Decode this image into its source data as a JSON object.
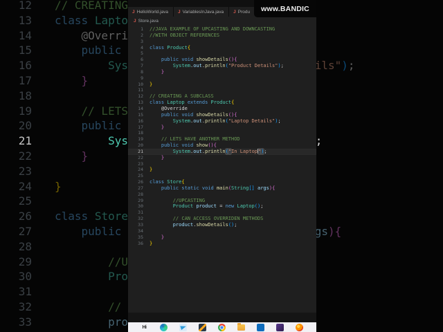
{
  "watermark": {
    "text": "www.BANDIC"
  },
  "window": {
    "tabs": [
      {
        "icon": "java-file-icon",
        "label": "HelloWorld.java"
      },
      {
        "icon": "java-file-icon",
        "label": "VariablesInJava.java"
      },
      {
        "icon": "java-file-icon",
        "label": "Produ"
      }
    ],
    "breadcrumb": {
      "icon": "java-file-icon",
      "label": "Store.java"
    }
  },
  "editor": {
    "language": "java",
    "current_line": 21,
    "lines": [
      {
        "n": 1,
        "tokens": [
          {
            "t": "//JAVA EXAMPLE OF UPCASTING AND DOWNCASTING",
            "c": "cm"
          }
        ]
      },
      {
        "n": 2,
        "tokens": [
          {
            "t": "//WITH OBJECT REFERENCES",
            "c": "cm"
          }
        ]
      },
      {
        "n": 3,
        "tokens": []
      },
      {
        "n": 4,
        "tokens": [
          {
            "t": "class",
            "c": "kw"
          },
          {
            "t": " ",
            "c": "tx"
          },
          {
            "t": "Product",
            "c": "cl"
          },
          {
            "t": "{",
            "c": "b1"
          }
        ]
      },
      {
        "n": 5,
        "tokens": []
      },
      {
        "n": 6,
        "tokens": [
          {
            "t": "    ",
            "c": "tx"
          },
          {
            "t": "public",
            "c": "kw"
          },
          {
            "t": " ",
            "c": "tx"
          },
          {
            "t": "void",
            "c": "kw"
          },
          {
            "t": " ",
            "c": "tx"
          },
          {
            "t": "showDetails",
            "c": "fn"
          },
          {
            "t": "(){",
            "c": "b2"
          }
        ]
      },
      {
        "n": 7,
        "tokens": [
          {
            "t": "        ",
            "c": "tx"
          },
          {
            "t": "System",
            "c": "cl"
          },
          {
            "t": ".",
            "c": "pu"
          },
          {
            "t": "out",
            "c": "pr"
          },
          {
            "t": ".",
            "c": "pu"
          },
          {
            "t": "println",
            "c": "fn"
          },
          {
            "t": "(",
            "c": "b3"
          },
          {
            "t": "\"Product Details\"",
            "c": "st"
          },
          {
            "t": ")",
            "c": "b3"
          },
          {
            "t": ";",
            "c": "tx"
          }
        ]
      },
      {
        "n": 8,
        "tokens": [
          {
            "t": "    ",
            "c": "tx"
          },
          {
            "t": "}",
            "c": "b2"
          }
        ]
      },
      {
        "n": 9,
        "tokens": []
      },
      {
        "n": 10,
        "tokens": [
          {
            "t": "}",
            "c": "b1"
          }
        ]
      },
      {
        "n": 11,
        "tokens": []
      },
      {
        "n": 12,
        "tokens": [
          {
            "t": "// CREATING A SUBCLASS",
            "c": "cm"
          }
        ]
      },
      {
        "n": 13,
        "tokens": [
          {
            "t": "class",
            "c": "kw"
          },
          {
            "t": " ",
            "c": "tx"
          },
          {
            "t": "Laptop",
            "c": "cl"
          },
          {
            "t": " ",
            "c": "tx"
          },
          {
            "t": "extends",
            "c": "kw"
          },
          {
            "t": " ",
            "c": "tx"
          },
          {
            "t": "Product",
            "c": "cl"
          },
          {
            "t": "{",
            "c": "b1"
          }
        ]
      },
      {
        "n": 14,
        "tokens": [
          {
            "t": "    @Override",
            "c": "tx"
          }
        ]
      },
      {
        "n": 15,
        "tokens": [
          {
            "t": "    ",
            "c": "tx"
          },
          {
            "t": "public",
            "c": "kw"
          },
          {
            "t": " ",
            "c": "tx"
          },
          {
            "t": "void",
            "c": "kw"
          },
          {
            "t": " ",
            "c": "tx"
          },
          {
            "t": "showDetails",
            "c": "fn"
          },
          {
            "t": "(){",
            "c": "b2"
          }
        ]
      },
      {
        "n": 16,
        "tokens": [
          {
            "t": "        ",
            "c": "tx"
          },
          {
            "t": "System",
            "c": "cl"
          },
          {
            "t": ".",
            "c": "pu"
          },
          {
            "t": "out",
            "c": "pr"
          },
          {
            "t": ".",
            "c": "pu"
          },
          {
            "t": "println",
            "c": "fn"
          },
          {
            "t": "(",
            "c": "b3"
          },
          {
            "t": "\"Laptop Details\"",
            "c": "st"
          },
          {
            "t": ")",
            "c": "b3"
          },
          {
            "t": ";",
            "c": "tx"
          }
        ]
      },
      {
        "n": 17,
        "tokens": [
          {
            "t": "    ",
            "c": "tx"
          },
          {
            "t": "}",
            "c": "b2"
          }
        ]
      },
      {
        "n": 18,
        "tokens": []
      },
      {
        "n": 19,
        "tokens": [
          {
            "t": "    ",
            "c": "tx"
          },
          {
            "t": "// LETS HAVE ANOTHER METHOD",
            "c": "cm"
          }
        ]
      },
      {
        "n": 20,
        "tokens": [
          {
            "t": "    ",
            "c": "tx"
          },
          {
            "t": "public",
            "c": "kw"
          },
          {
            "t": " ",
            "c": "tx"
          },
          {
            "t": "void",
            "c": "kw"
          },
          {
            "t": " ",
            "c": "tx"
          },
          {
            "t": "show",
            "c": "fn"
          },
          {
            "t": "(){",
            "c": "b2"
          }
        ]
      },
      {
        "n": 21,
        "tokens": [
          {
            "t": "        ",
            "c": "tx"
          },
          {
            "t": "System",
            "c": "cl"
          },
          {
            "t": ".",
            "c": "pu"
          },
          {
            "t": "out",
            "c": "pr"
          },
          {
            "t": ".",
            "c": "pu"
          },
          {
            "t": "println",
            "c": "fn"
          },
          {
            "t": "(",
            "c": "b3 h"
          },
          {
            "t": "\"",
            "c": "st h"
          },
          {
            "t": "In Laptop",
            "c": "st"
          },
          {
            "t": "",
            "c": "tx",
            "cur": true
          },
          {
            "t": "\"",
            "c": "st h"
          },
          {
            "t": ")",
            "c": "b3 h"
          },
          {
            "t": ";",
            "c": "tx"
          }
        ]
      },
      {
        "n": 22,
        "tokens": [
          {
            "t": "    ",
            "c": "tx"
          },
          {
            "t": "}",
            "c": "b2"
          }
        ]
      },
      {
        "n": 23,
        "tokens": []
      },
      {
        "n": 24,
        "tokens": [
          {
            "t": "}",
            "c": "b1"
          }
        ]
      },
      {
        "n": 25,
        "tokens": []
      },
      {
        "n": 26,
        "tokens": [
          {
            "t": "class",
            "c": "kw"
          },
          {
            "t": " ",
            "c": "tx"
          },
          {
            "t": "Store",
            "c": "cl"
          },
          {
            "t": "{",
            "c": "b1"
          }
        ]
      },
      {
        "n": 27,
        "tokens": [
          {
            "t": "    ",
            "c": "tx"
          },
          {
            "t": "public",
            "c": "kw"
          },
          {
            "t": " ",
            "c": "tx"
          },
          {
            "t": "static",
            "c": "kw"
          },
          {
            "t": " ",
            "c": "tx"
          },
          {
            "t": "void",
            "c": "kw"
          },
          {
            "t": " ",
            "c": "tx"
          },
          {
            "t": "main",
            "c": "fn"
          },
          {
            "t": "(",
            "c": "b2"
          },
          {
            "t": "String",
            "c": "cl"
          },
          {
            "t": "[]",
            "c": "b3"
          },
          {
            "t": " ",
            "c": "tx"
          },
          {
            "t": "args",
            "c": "pr"
          },
          {
            "t": "){",
            "c": "b2"
          }
        ]
      },
      {
        "n": 28,
        "tokens": []
      },
      {
        "n": 29,
        "tokens": [
          {
            "t": "        ",
            "c": "tx"
          },
          {
            "t": "//UPCASTING",
            "c": "cm"
          }
        ]
      },
      {
        "n": 30,
        "tokens": [
          {
            "t": "        ",
            "c": "tx"
          },
          {
            "t": "Product",
            "c": "cl"
          },
          {
            "t": " ",
            "c": "tx"
          },
          {
            "t": "product",
            "c": "pr"
          },
          {
            "t": " ",
            "c": "tx"
          },
          {
            "t": "=",
            "c": "pu"
          },
          {
            "t": " ",
            "c": "tx"
          },
          {
            "t": "new",
            "c": "kw"
          },
          {
            "t": " ",
            "c": "tx"
          },
          {
            "t": "Laptop",
            "c": "cl"
          },
          {
            "t": "()",
            "c": "b3"
          },
          {
            "t": ";",
            "c": "tx"
          }
        ]
      },
      {
        "n": 31,
        "tokens": []
      },
      {
        "n": 32,
        "tokens": [
          {
            "t": "        ",
            "c": "tx"
          },
          {
            "t": "// CAN ACCESS OVERRIDEN METHODS",
            "c": "cm"
          }
        ]
      },
      {
        "n": 33,
        "tokens": [
          {
            "t": "        ",
            "c": "tx"
          },
          {
            "t": "product",
            "c": "pr"
          },
          {
            "t": ".",
            "c": "pu"
          },
          {
            "t": "showDetails",
            "c": "fn"
          },
          {
            "t": "()",
            "c": "b3"
          },
          {
            "t": ";",
            "c": "tx"
          }
        ]
      },
      {
        "n": 34,
        "tokens": []
      },
      {
        "n": 35,
        "tokens": [
          {
            "t": "    ",
            "c": "tx"
          },
          {
            "t": "}",
            "c": "b2"
          }
        ]
      },
      {
        "n": 36,
        "tokens": [
          {
            "t": "}",
            "c": "b1"
          }
        ]
      }
    ]
  },
  "background_code": {
    "from_line": 12,
    "to_line": 33,
    "highlight_line": 21
  },
  "taskbar": {
    "icons": [
      {
        "name": "app-h",
        "glyph": "Hi"
      },
      {
        "name": "edge"
      },
      {
        "name": "telegram",
        "active": true
      },
      {
        "name": "code-app"
      },
      {
        "name": "chrome"
      },
      {
        "name": "file-explorer"
      },
      {
        "name": "outlook",
        "glyph": "O"
      },
      {
        "name": "purple-box-app"
      },
      {
        "name": "firefox"
      }
    ]
  },
  "colors": {
    "editor_bg": "#1f1f1f",
    "comment": "#6a9955",
    "keyword": "#569cd6",
    "class": "#4ec9b0",
    "method": "#dcdcaa",
    "string": "#ce9178",
    "member": "#9cdcfe",
    "bracket1": "#ffd700",
    "bracket2": "#da70d6",
    "bracket3": "#179fff",
    "java_icon": "#d3584e",
    "taskbar_bg": "#f2f1f5"
  }
}
